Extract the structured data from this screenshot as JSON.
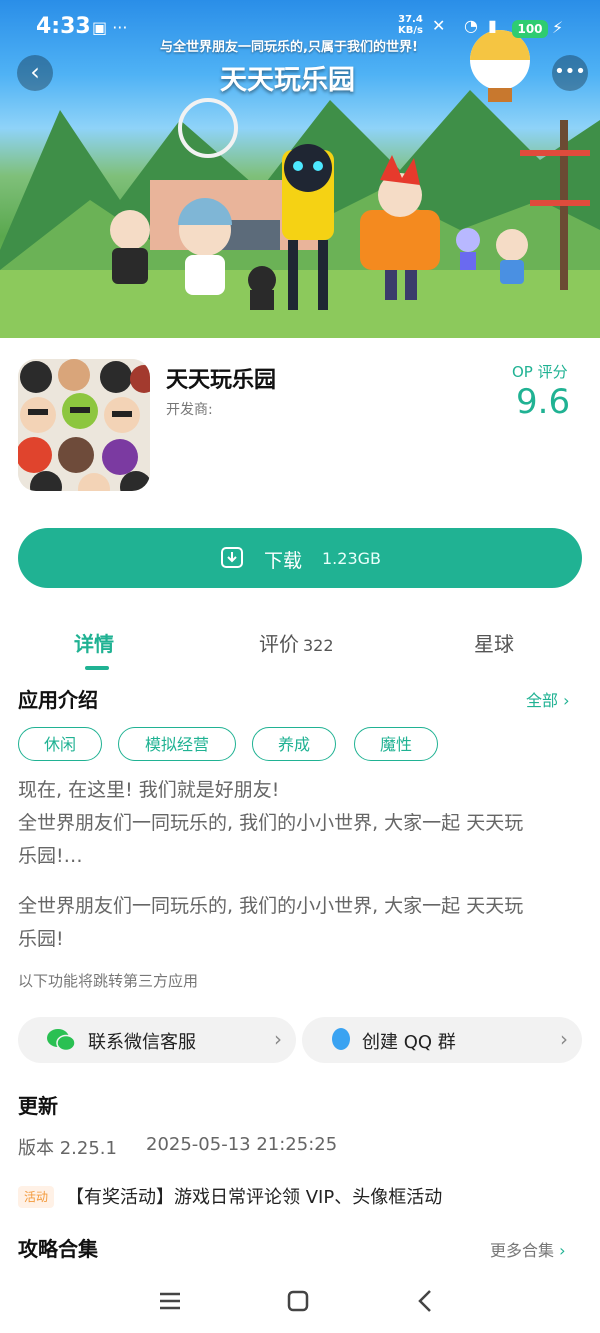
{
  "status_bar": {
    "time": "4:33",
    "speed_value": "37.4",
    "speed_unit": "KB/s",
    "battery": "100"
  },
  "banner": {
    "subtitle": "与全世界朋友一同玩乐的,只属于我们的世界!",
    "title": "天天玩乐园"
  },
  "app": {
    "name": "天天玩乐园",
    "developer_label": "开发商:",
    "rating_label": "OP 评分",
    "rating_value": "9.6"
  },
  "download": {
    "label": "下载",
    "size": "1.23GB"
  },
  "tabs": [
    {
      "label": "详情"
    },
    {
      "label": "评价",
      "count": "322"
    },
    {
      "label": "星球"
    }
  ],
  "intro": {
    "title": "应用介绍",
    "all_label": "全部",
    "tags": [
      "休闲",
      "模拟经营",
      "养成",
      "魔性"
    ],
    "desc_line1": "现在, 在这里! 我们就是好朋友!",
    "desc_line2": "全世界朋友们一同玩乐的, 我们的小小世界, 大家一起 天天玩",
    "desc_line3": "乐园!…",
    "desc2_line1": "全世界朋友们一同玩乐的, 我们的小小世界, 大家一起 天天玩",
    "desc2_line2": "乐园!",
    "third_party_hint": "以下功能将跳转第三方应用"
  },
  "services": {
    "wechat": "联系微信客服",
    "qq": "创建 QQ 群"
  },
  "update": {
    "title": "更新",
    "version": "版本 2.25.1",
    "date": "2025-05-13 21:25:25",
    "badge": "活动",
    "activity": "【有奖活动】游戏日常评论领 VIP、头像框活动"
  },
  "guides": {
    "title": "攻略合集",
    "more_label": "更多合集"
  },
  "colors": {
    "accent": "#20b293",
    "badge_bg": "#fff1e6",
    "badge_text": "#f39a3c"
  }
}
